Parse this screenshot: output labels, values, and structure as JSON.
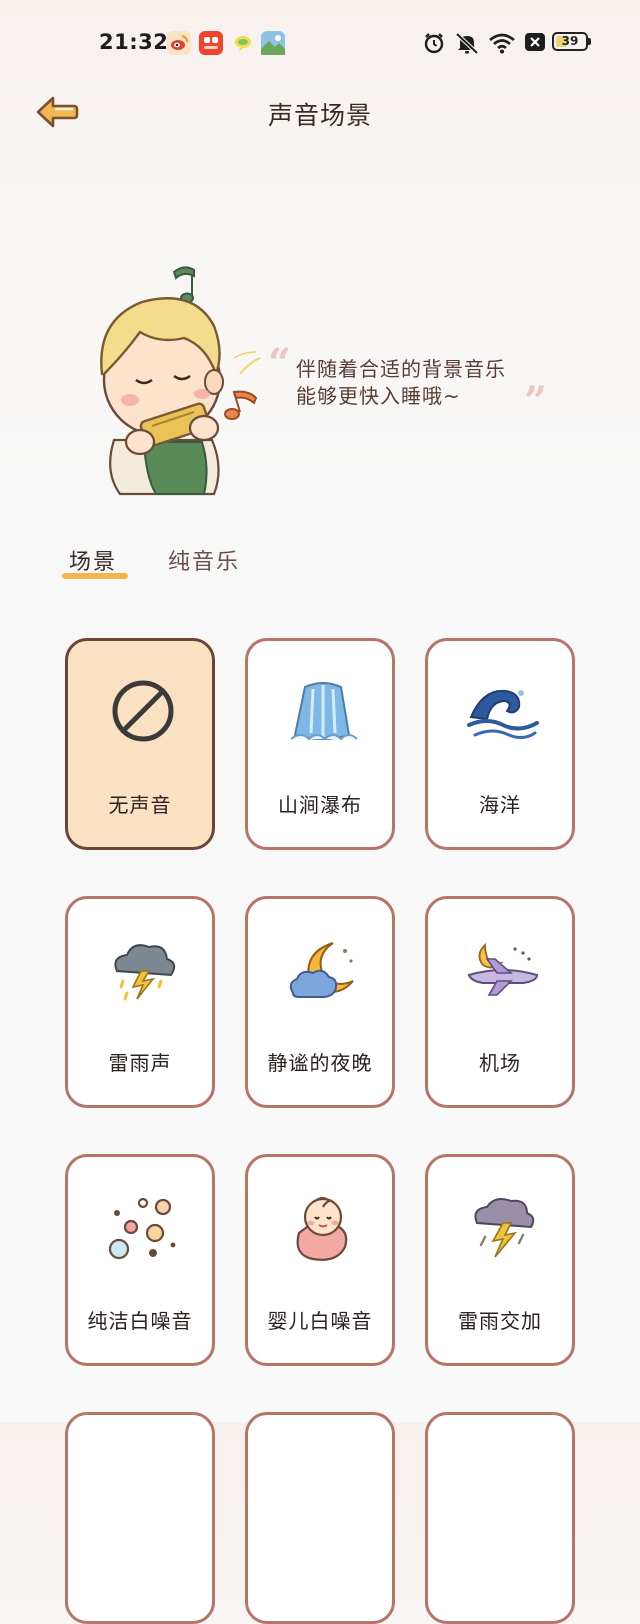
{
  "status_bar": {
    "time": "21:32",
    "notification_icons": [
      "weibo-icon",
      "kuaishou-icon",
      "bubble-app-icon",
      "photo-app-icon"
    ],
    "system_icons": [
      "alarm-icon",
      "mute-bell-icon",
      "wifi-icon",
      "close-box-icon"
    ],
    "battery_level": "39"
  },
  "header": {
    "back_icon": "back-arrow-icon",
    "title": "声音场景"
  },
  "hero": {
    "line1": "伴随着合适的背景音乐",
    "line2": "能够更快入睡哦~",
    "open_quote": "“",
    "close_quote": "”"
  },
  "tabs": [
    {
      "label": "场景",
      "active": true
    },
    {
      "label": "纯音乐",
      "active": false
    }
  ],
  "colors": {
    "accent": "#f2b650",
    "card_border": "#b67568",
    "selected_card_bg": "#fae1c2"
  },
  "scenes": [
    {
      "label": "无声音",
      "icon": "no-sound-icon",
      "selected": true
    },
    {
      "label": "山涧瀑布",
      "icon": "waterfall-icon",
      "selected": false
    },
    {
      "label": "海洋",
      "icon": "ocean-wave-icon",
      "selected": false
    },
    {
      "label": "雷雨声",
      "icon": "thunderstorm-icon",
      "selected": false
    },
    {
      "label": "静谧的夜晚",
      "icon": "moon-cloud-icon",
      "selected": false
    },
    {
      "label": "机场",
      "icon": "airplane-icon",
      "selected": false
    },
    {
      "label": "纯洁白噪音",
      "icon": "bubbles-icon",
      "selected": false
    },
    {
      "label": "婴儿白噪音",
      "icon": "baby-icon",
      "selected": false
    },
    {
      "label": "雷雨交加",
      "icon": "lightning-cloud-icon",
      "selected": false
    }
  ]
}
